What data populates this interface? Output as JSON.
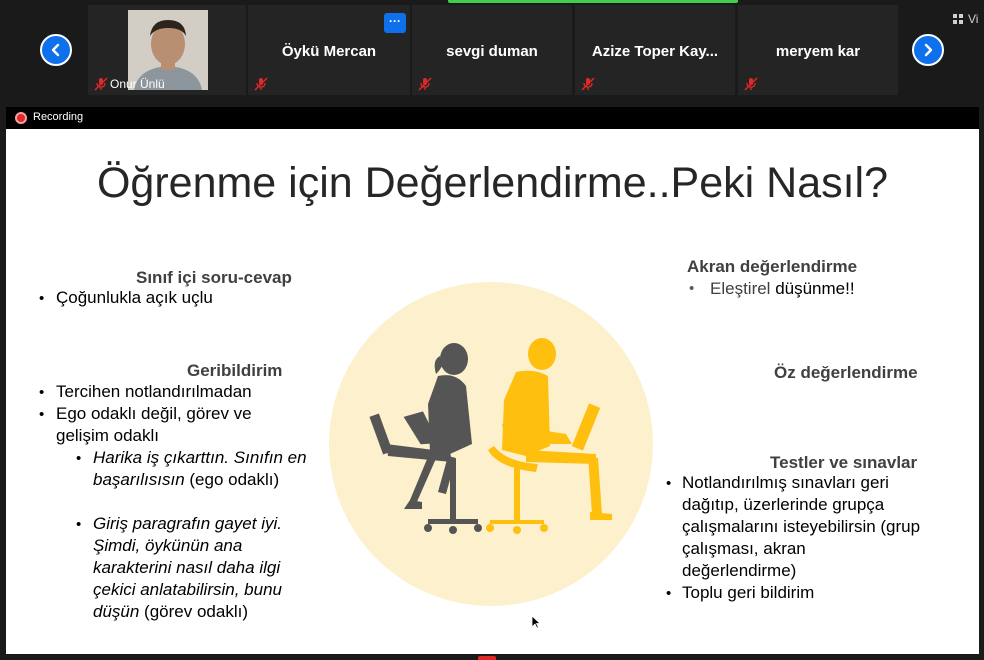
{
  "participants": {
    "self": {
      "name": "Onur Ünlü"
    },
    "tiles": [
      {
        "name": "Öykü Mercan"
      },
      {
        "name": "sevgi duman"
      },
      {
        "name": "Azize Toper Kay..."
      },
      {
        "name": "meryem kar"
      }
    ],
    "more_label": "···",
    "view_label": "Vi"
  },
  "recording": {
    "label": "Recording"
  },
  "slide": {
    "title": "Öğrenme için Değerlendirme..Peki Nasıl?",
    "left": {
      "heading1": "Sınıf içi soru-cevap",
      "bullet1": "Çoğunlukla açık uçlu",
      "heading2": "Geribildirim",
      "bullet2": "Tercihen notlandırılmadan",
      "bullet3a": "Ego odaklı değil, görev ve",
      "bullet3b": "gelişim odaklı",
      "sub1_italic": "Harika iş çıkarttın. Sınıfın en başarılısısın",
      "sub1_plain": " (ego odaklı)",
      "sub2_italic": "Giriş paragrafın gayet iyi. Şimdi, öykünün ana karakterini nasıl daha ilgi çekici anlatabilirsin, bunu düşün",
      "sub2_plain": " (görev odaklı)"
    },
    "right": {
      "heading1": "Akran değerlendirme",
      "bullet1_a": "Eleştirel",
      "bullet1_b": " düşünme!!",
      "heading2": "Öz değerlendirme",
      "heading3": "Testler ve sınavlar",
      "bullet2": "Notlandırılmış sınavları geri dağıtıp, üzerlerinde grupça çalışmalarını isteyebilirsin (grup çalışması, akran değerlendirme)",
      "bullet3": "Toplu geri bildirim"
    },
    "colors": {
      "circle": "#fdf0cc",
      "figure_dark": "#555555",
      "figure_yellow": "#ffbf0f"
    }
  }
}
